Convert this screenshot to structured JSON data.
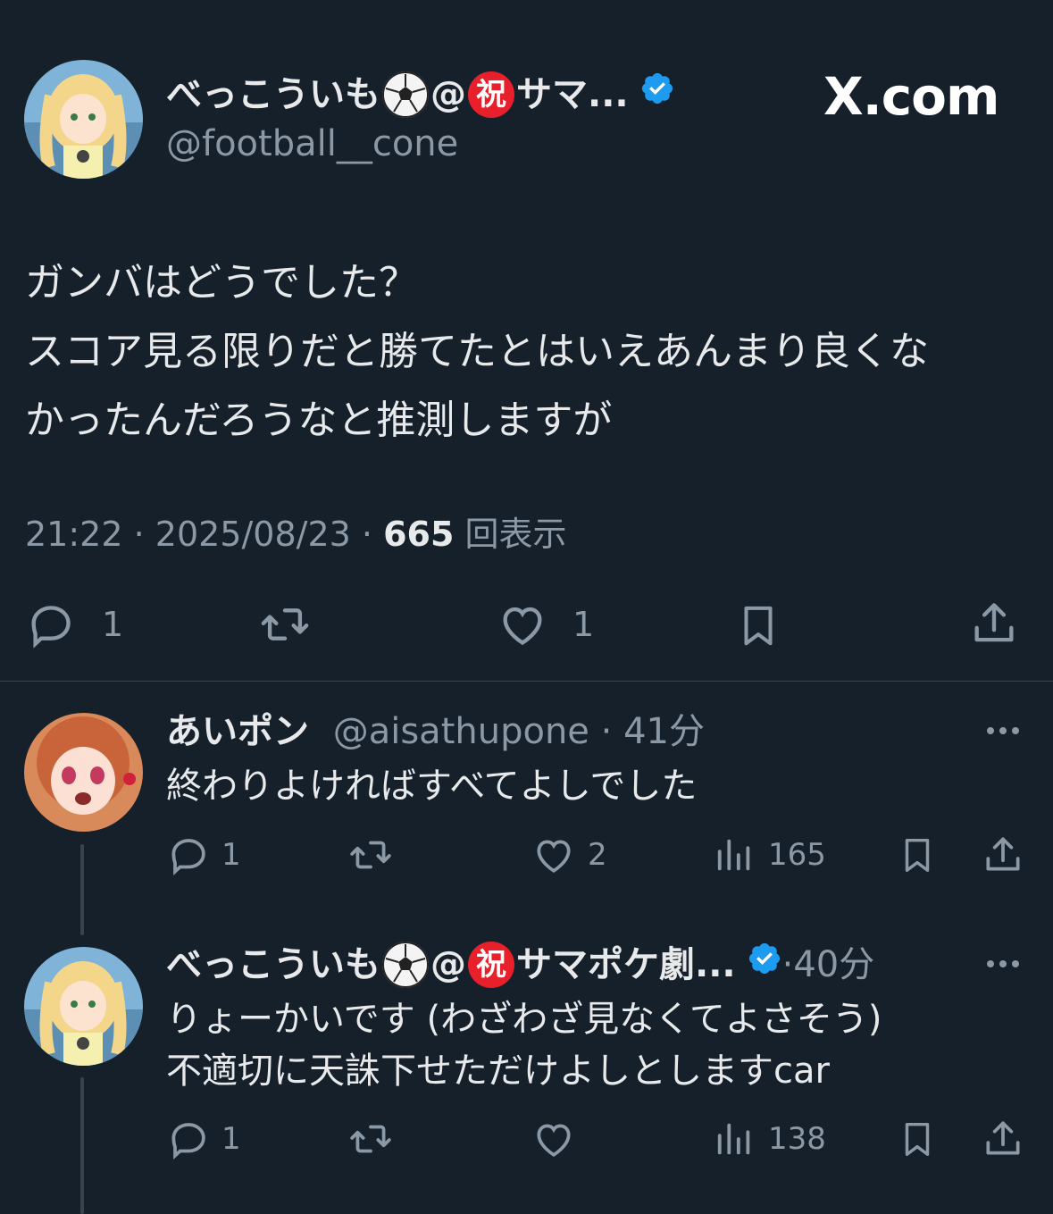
{
  "main_tweet": {
    "display_name": "べっこういも",
    "name_suffix": "サマ...",
    "at_sign": "@",
    "shuku_char": "祝",
    "handle": "@football__cone",
    "brand": "X.com",
    "text_lines": [
      "ガンバはどうでした？",
      "スコア見る限りだと勝てたとはいえあんまり良くな",
      "かったんだろうなと推測しますが"
    ],
    "time": "21:22",
    "date": "2025/08/23",
    "views": "665",
    "views_label": "回表示",
    "reply_count": "1",
    "like_count": "1"
  },
  "replies": [
    {
      "display_name": "あいポン",
      "handle": "@aisathupone",
      "age": "41分",
      "text_lines": [
        "終わりよければすべてよしでした"
      ],
      "reply_count": "1",
      "like_count": "2",
      "view_count": "165"
    },
    {
      "display_name": "べっこういも",
      "name_suffix": "サマポケ劇...",
      "at_sign": "@",
      "shuku_char": "祝",
      "age": "40分",
      "text_lines": [
        "りょーかいです (わざわざ見なくてよさそう)",
        "不適切に天誅下せただけよしとしますcar"
      ],
      "reply_count": "1",
      "like_count": "",
      "view_count": "138"
    }
  ],
  "colors": {
    "background": "#15202b",
    "text": "#e7e9ea",
    "muted": "#8b98a5",
    "verified": "#1d9bf0",
    "divider": "#38444d"
  }
}
